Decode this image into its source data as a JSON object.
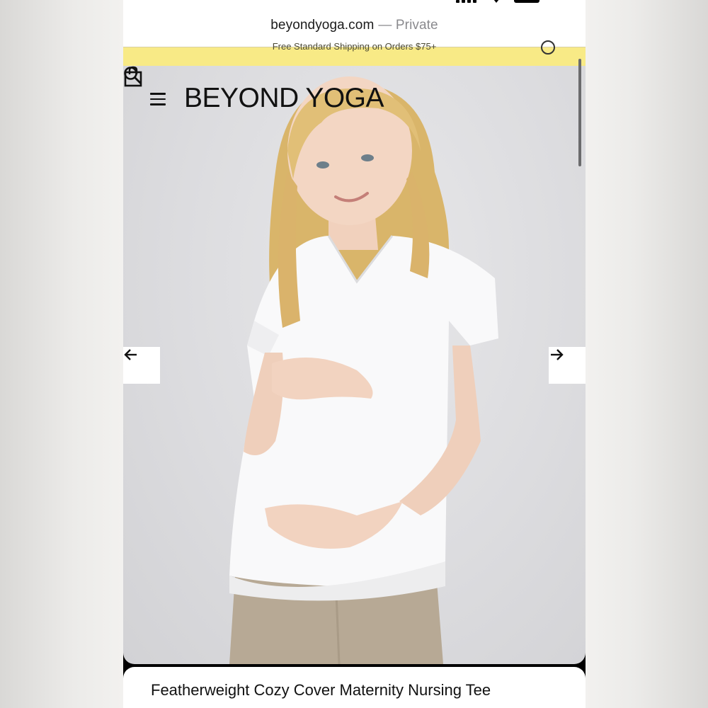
{
  "browser": {
    "url": "beyondyoga.com",
    "separator": "—",
    "mode": "Private"
  },
  "promo": {
    "text": "Free Standard Shipping on Orders $75+"
  },
  "header": {
    "brand": "BEYOND YOGA",
    "icons": [
      "menu-icon",
      "search-icon",
      "shopping-bag-icon"
    ]
  },
  "carousel": {
    "prev_icon": "arrow-left-icon",
    "next_icon": "arrow-right-icon"
  },
  "product": {
    "title": "Featherweight Cozy Cover Maternity Nursing Tee"
  },
  "colors": {
    "promo_bar": "#f8ea86",
    "hero_background": "#dcdcdf",
    "text": "#111111"
  }
}
